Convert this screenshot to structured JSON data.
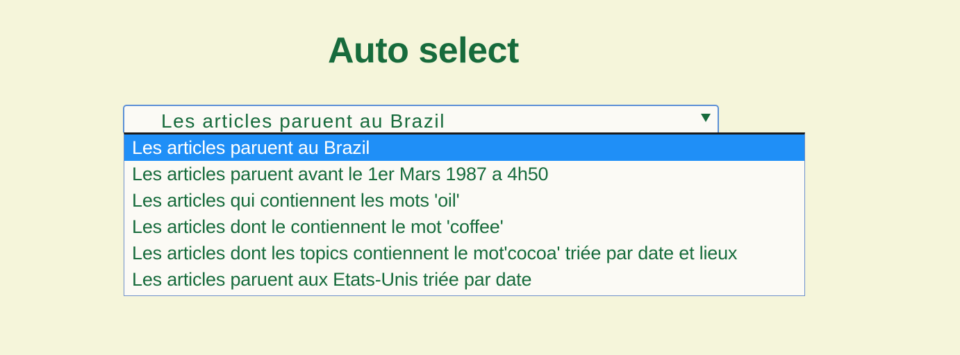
{
  "page": {
    "title": "Auto select"
  },
  "select": {
    "value": "Les articles paruent au Brazil",
    "icon": "chevron-down-icon",
    "options": [
      "Les articles paruent au Brazil",
      "Les articles paruent avant le 1er Mars 1987 a 4h50",
      "Les articles qui contiennent les mots 'oil'",
      "Les articles dont le contiennent le mot 'coffee'",
      "Les articles dont les topics contiennent le mot'cocoa' triée par date et lieux",
      "Les articles paruent aux Etats-Unis triée par date"
    ],
    "selected_index": 0
  },
  "colors": {
    "background": "#f5f5da",
    "text": "#176b3c",
    "highlight": "#1f8ff7",
    "border": "#5b8fd6"
  }
}
